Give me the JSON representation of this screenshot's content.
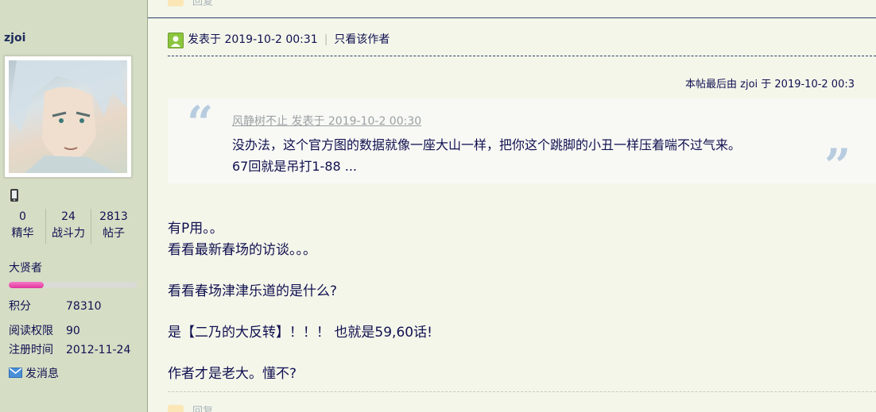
{
  "top_reply": {
    "label": "回复"
  },
  "bottom_reply": {
    "label": "回复"
  },
  "user": {
    "name": "zjoi",
    "stats": [
      {
        "value": "0",
        "label": "精华"
      },
      {
        "value": "24",
        "label": "战斗力"
      },
      {
        "value": "2813",
        "label": "帖子"
      }
    ],
    "rank": "大贤者",
    "rank_progress": 0.27,
    "info": [
      {
        "key": "积分",
        "value": "78310"
      },
      {
        "key": "阅读权限",
        "value": "90"
      },
      {
        "key": "注册时间",
        "value": "2012-11-24"
      }
    ],
    "send_message": "发消息"
  },
  "post": {
    "posted_at": "发表于 2019-10-2 00:31",
    "separator": "|",
    "only_author": "只看该作者",
    "edit_note": "本帖最后由 zjoi 于 2019-10-2 00:3",
    "quote": {
      "author_line": "风静树不止 发表于 2019-10-2 00:30",
      "lines": [
        "没办法，这个官方图的数据就像一座大山一样，把你这个跳脚的小丑一样压着喘不过气来。",
        "67回就是吊打1-88 ..."
      ]
    },
    "body": [
      "有P用。。",
      "看看最新春场的访谈。。。",
      "看看春场津津乐道的是什么?",
      "是【二乃的大反转】！！！ 也就是59,60话!",
      "作者才是老大。懂不?"
    ]
  }
}
